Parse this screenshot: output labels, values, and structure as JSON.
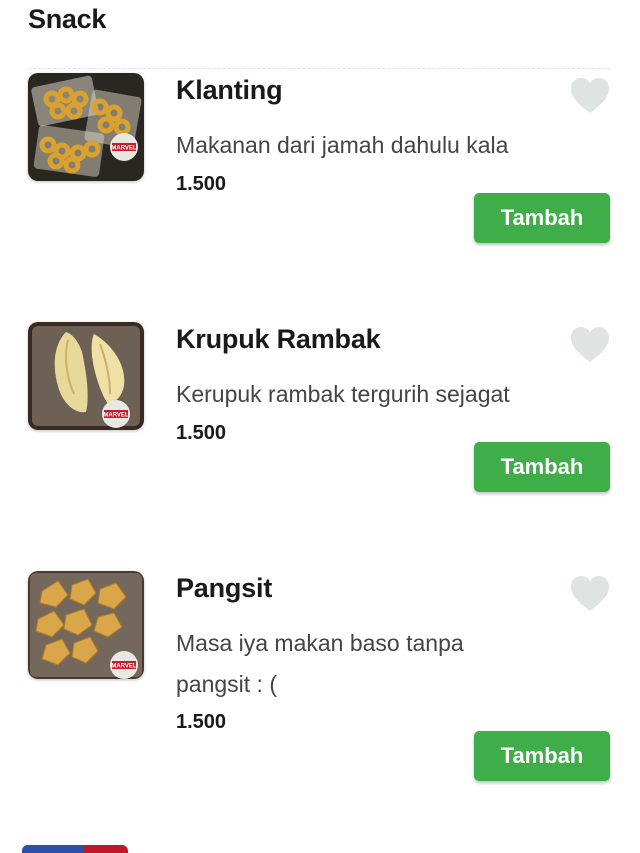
{
  "section": {
    "title": "Snack"
  },
  "items": [
    {
      "name": "Klanting",
      "description": "Makanan dari jamah dahulu kala",
      "price": "1.500",
      "button_label": "Tambah",
      "favorite_icon": "heart-icon",
      "image_label": "MARVEL"
    },
    {
      "name": "Krupuk Rambak",
      "description": "Kerupuk rambak tergurih sejagat",
      "price": "1.500",
      "button_label": "Tambah",
      "favorite_icon": "heart-icon",
      "image_label": "MARVEL"
    },
    {
      "name": "Pangsit",
      "description": "Masa iya makan baso tanpa pangsit : (",
      "price": "1.500",
      "button_label": "Tambah",
      "favorite_icon": "heart-icon",
      "image_label": "MARVEL"
    }
  ],
  "colors": {
    "accent_green": "#3fae49",
    "favorite_inactive": "#dfe3e2",
    "text_primary": "#1a1a1a",
    "text_secondary": "#444444"
  }
}
